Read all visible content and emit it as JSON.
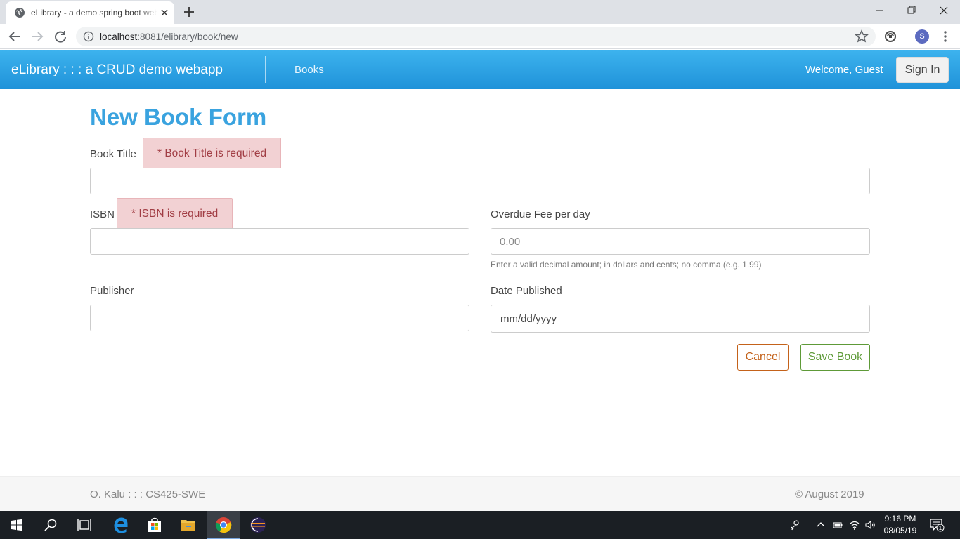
{
  "browser": {
    "tab_title": "eLibrary - a demo spring boot webapp",
    "url_host": "localhost",
    "url_rest": ":8081/elibrary/book/new",
    "profile_initial": "S"
  },
  "navbar": {
    "brand": "eLibrary : : : a CRUD demo webapp",
    "books_link": "Books",
    "welcome": "Welcome, Guest",
    "signin_label": "Sign In",
    "colors": {
      "gradient_top": "#3db3ee",
      "gradient_bottom": "#1f92d9"
    }
  },
  "form": {
    "title": "New Book Form",
    "book_title": {
      "label": "Book Title",
      "error": "* Book Title is required",
      "value": ""
    },
    "isbn": {
      "label": "ISBN",
      "error": "* ISBN is required",
      "value": ""
    },
    "overdue_fee": {
      "label": "Overdue Fee per day",
      "placeholder": "0.00",
      "help": "Enter a valid decimal amount; in dollars and cents; no comma (e.g. 1.99)"
    },
    "publisher": {
      "label": "Publisher",
      "value": ""
    },
    "date_published": {
      "label": "Date Published",
      "placeholder": "mm/dd/yyyy"
    },
    "cancel_label": "Cancel",
    "save_label": "Save Book"
  },
  "footer": {
    "left": "O. Kalu : : : CS425-SWE",
    "right": "© August 2019"
  },
  "taskbar": {
    "time": "9:16 PM",
    "date": "08/05/19",
    "notification_count": "1",
    "apps": [
      "windows-start-icon",
      "search-icon",
      "task-view-icon",
      "edge-icon",
      "store-icon",
      "file-explorer-icon",
      "chrome-icon",
      "eclipse-icon"
    ]
  }
}
